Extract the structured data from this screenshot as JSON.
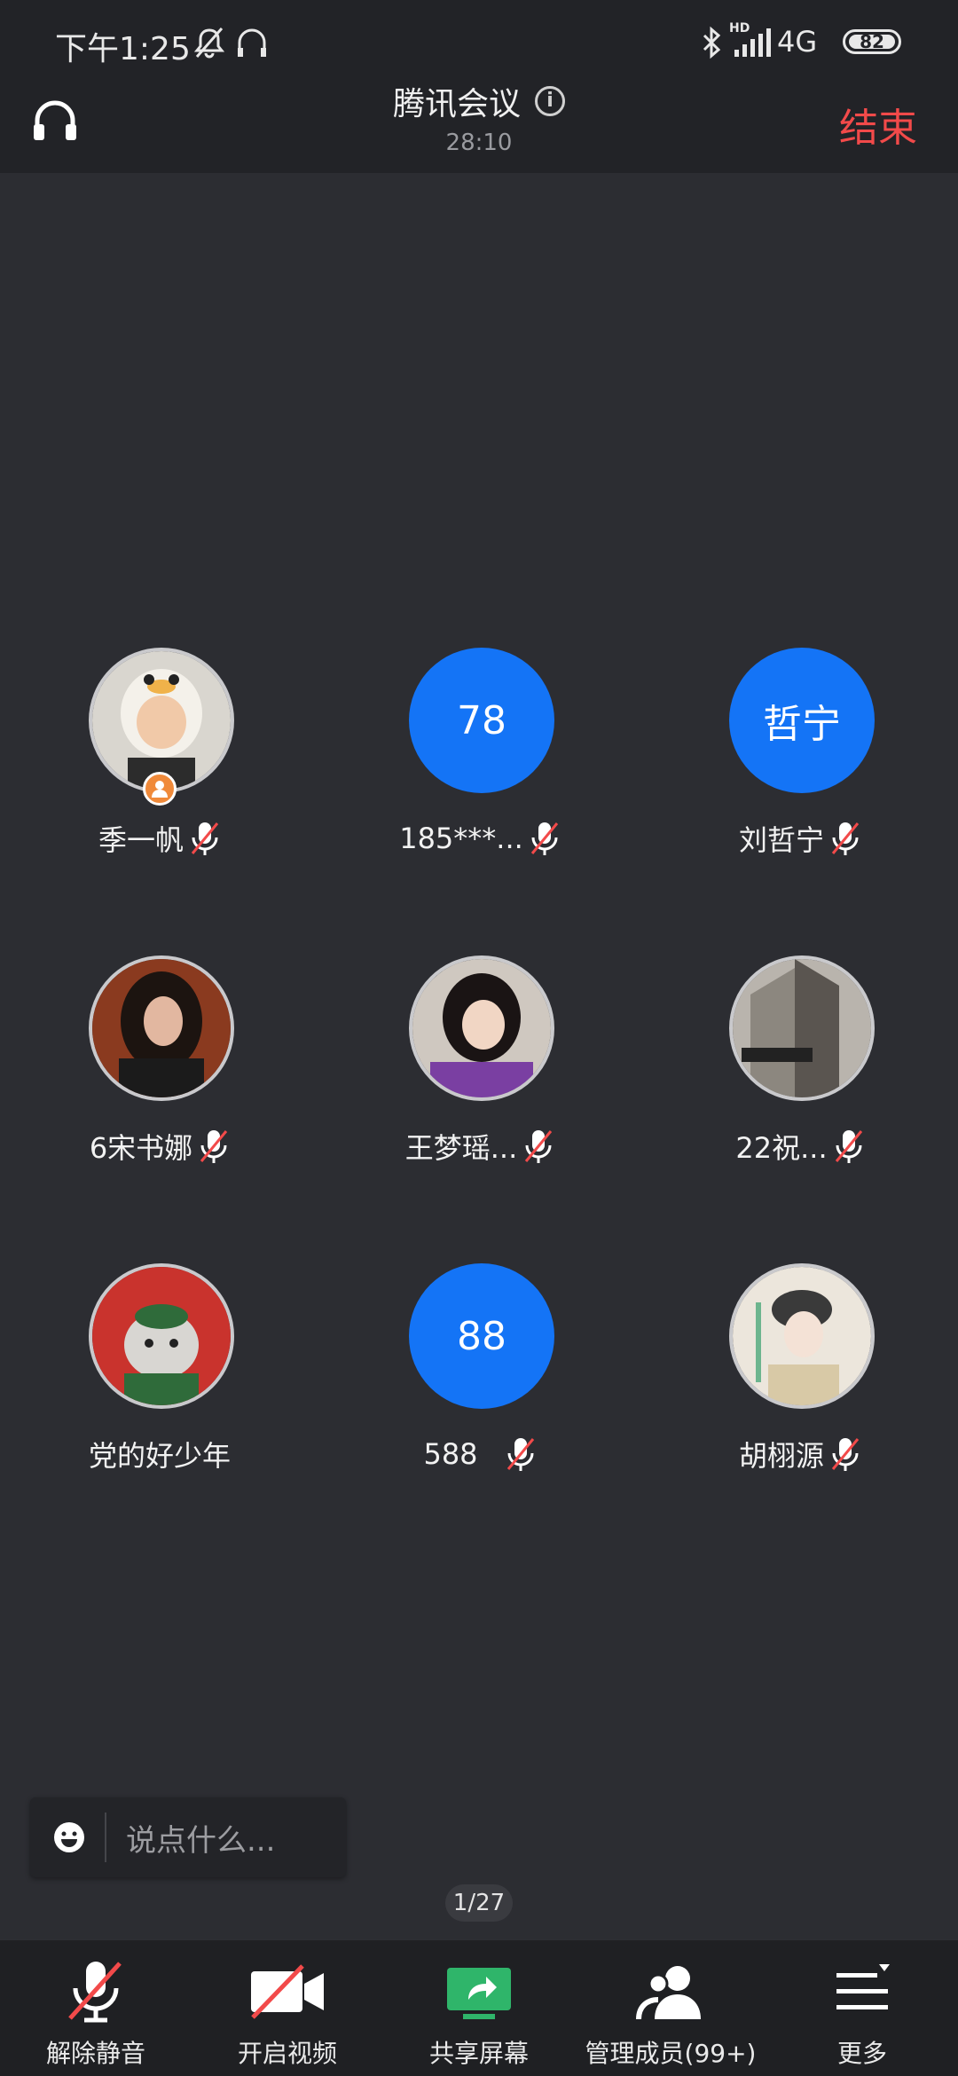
{
  "status_bar": {
    "time": "下午1:25",
    "network": "4G",
    "hd": "HD",
    "battery": "82"
  },
  "header": {
    "title": "腾讯会议",
    "timer": "28:10",
    "end_label": "结束"
  },
  "participants": [
    {
      "name": "季一帆",
      "avatar_type": "photo",
      "is_host": true
    },
    {
      "name": "185***...",
      "avatar_type": "number",
      "avatar_text": "78"
    },
    {
      "name": "刘哲宁",
      "avatar_type": "number",
      "avatar_text": "哲宁"
    },
    {
      "name": "6宋书娜",
      "avatar_type": "photo"
    },
    {
      "name": "王梦瑶...",
      "avatar_type": "photo"
    },
    {
      "name": "22祝...",
      "avatar_type": "photo"
    },
    {
      "name": "党的好少年",
      "avatar_type": "photo"
    },
    {
      "name": "588",
      "avatar_type": "number",
      "avatar_text": "88"
    },
    {
      "name": "胡栩源",
      "avatar_type": "photo"
    }
  ],
  "chat": {
    "placeholder": "说点什么..."
  },
  "pagination": "1/27",
  "toolbar": {
    "unmute": "解除静音",
    "video": "开启视频",
    "share": "共享屏幕",
    "members": "管理成员(99+)",
    "more": "更多"
  },
  "colors": {
    "accent_blue": "#1474f6",
    "end_red": "#f24a4a",
    "share_green": "#2fb56a",
    "background": "#2c2d32"
  }
}
